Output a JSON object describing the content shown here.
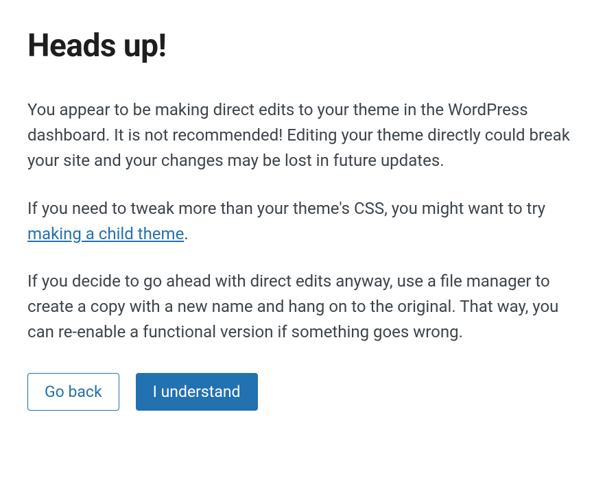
{
  "dialog": {
    "title": "Heads up!",
    "paragraph1": "You appear to be making direct edits to your theme in the WordPress dashboard. It is not recommended! Editing your theme directly could break your site and your changes may be lost in future updates.",
    "paragraph2_before": "If you need to tweak more than your theme's CSS, you might want to try ",
    "paragraph2_link": "making a child theme",
    "paragraph2_after": ".",
    "paragraph3": "If you decide to go ahead with direct edits anyway, use a file manager to create a copy with a new name and hang on to the original. That way, you can re-enable a functional version if something goes wrong.",
    "buttons": {
      "back": "Go back",
      "confirm": "I understand"
    }
  }
}
